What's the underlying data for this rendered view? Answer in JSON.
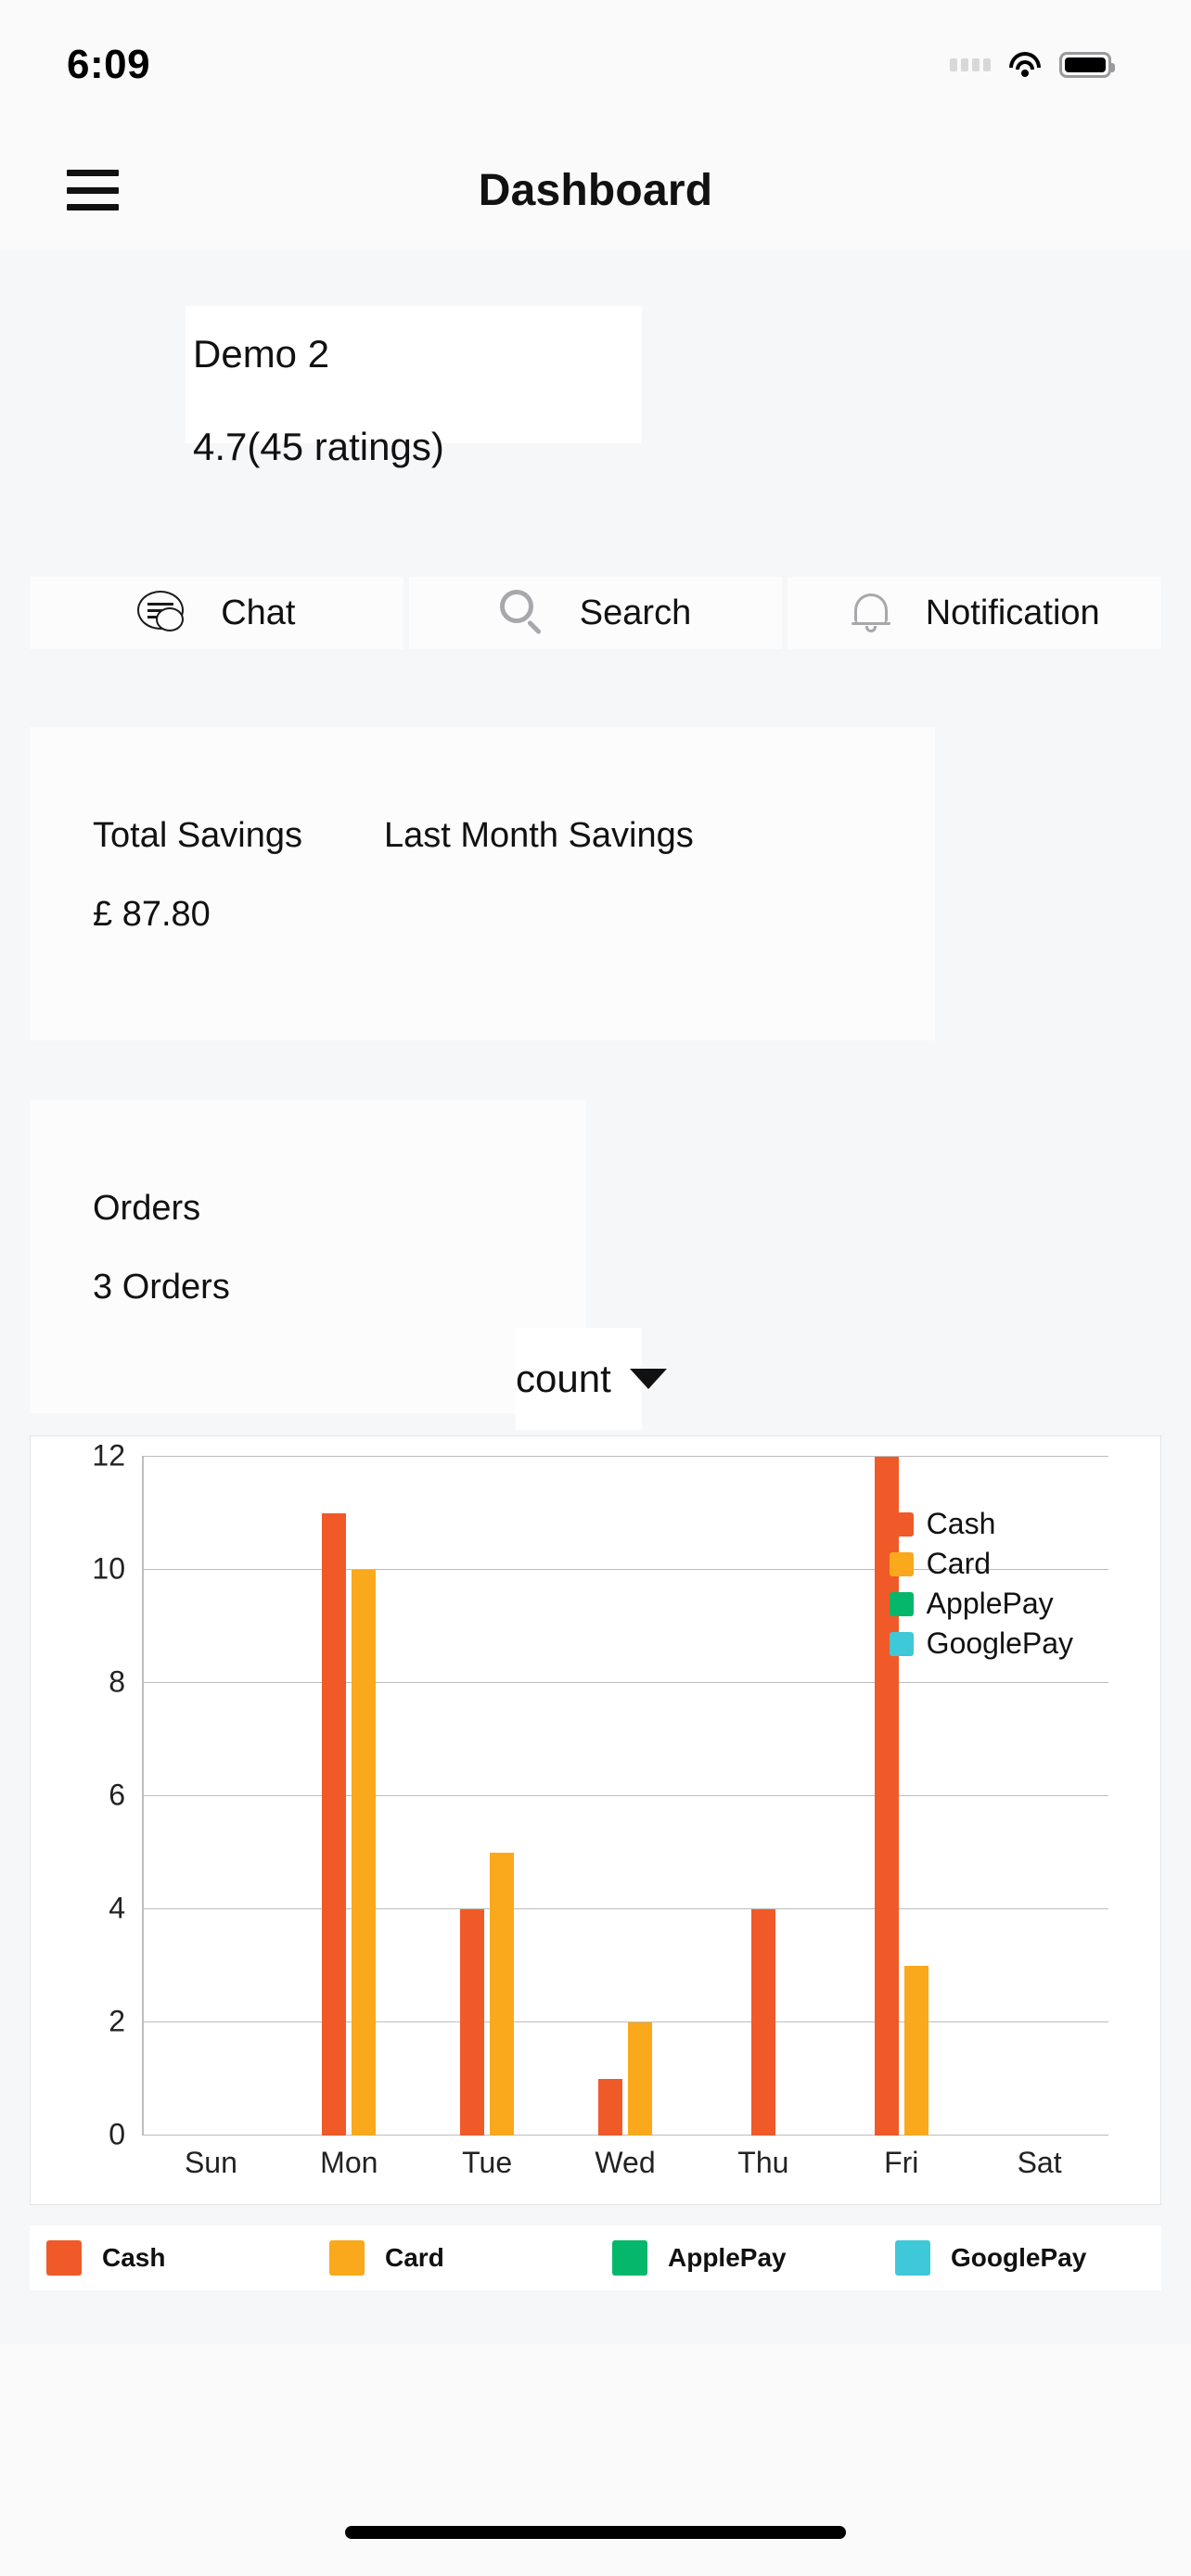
{
  "status_bar": {
    "time": "6:09",
    "icons": [
      "cellular-dots-icon",
      "wifi-icon",
      "battery-icon"
    ]
  },
  "nav": {
    "menu_icon": "hamburger-menu-icon",
    "title": "Dashboard"
  },
  "store_card": {
    "name": "Demo 2",
    "rating": "4.7(45 ratings)"
  },
  "actions": [
    {
      "icon": "chat-bubble-icon",
      "label": "Chat"
    },
    {
      "icon": "search-icon",
      "label": "Search"
    },
    {
      "icon": "bell-icon",
      "label": "Notification"
    }
  ],
  "stats": {
    "total_savings": {
      "title": "Total Savings",
      "value": "£ 87.80"
    },
    "last_month_savings": {
      "title": "Last Month Savings",
      "value": ""
    },
    "orders": {
      "title": "Orders",
      "value": "3 Orders"
    }
  },
  "metric_select": {
    "value": "count",
    "caret_icon": "chevron-down-icon",
    "options": [
      "count"
    ]
  },
  "colors": {
    "cash": "#ef5a28",
    "card": "#f9a91b",
    "applepay": "#04b76b",
    "googlepay": "#3ec8d8",
    "grid": "#bdbdbd",
    "card_bg": "#ffffff",
    "page_bg": "#f6f7f9"
  },
  "chart_data": {
    "type": "bar",
    "title": "",
    "xlabel": "",
    "ylabel": "",
    "categories": [
      "Sun",
      "Mon",
      "Tue",
      "Wed",
      "Thu",
      "Fri",
      "Sat"
    ],
    "series": [
      {
        "name": "Cash",
        "color": "#ef5a28",
        "values": [
          0,
          11,
          4,
          1,
          4,
          12,
          0
        ]
      },
      {
        "name": "Card",
        "color": "#f9a91b",
        "values": [
          0,
          10,
          5,
          2,
          0,
          3,
          0
        ]
      },
      {
        "name": "ApplePay",
        "color": "#04b76b",
        "values": [
          0,
          0,
          0,
          0,
          0,
          0,
          0
        ]
      },
      {
        "name": "GooglePay",
        "color": "#3ec8d8",
        "values": [
          0,
          0,
          0,
          0,
          0,
          0,
          0
        ]
      }
    ],
    "ylim": [
      0,
      12
    ],
    "yticks": [
      0,
      2,
      4,
      6,
      8,
      10,
      12
    ],
    "grid": true,
    "legend_position": "top-right"
  },
  "legend": [
    {
      "label": "Cash",
      "color": "#ef5a28"
    },
    {
      "label": "Card",
      "color": "#f9a91b"
    },
    {
      "label": "ApplePay",
      "color": "#04b76b"
    },
    {
      "label": "GooglePay",
      "color": "#3ec8d8"
    }
  ]
}
